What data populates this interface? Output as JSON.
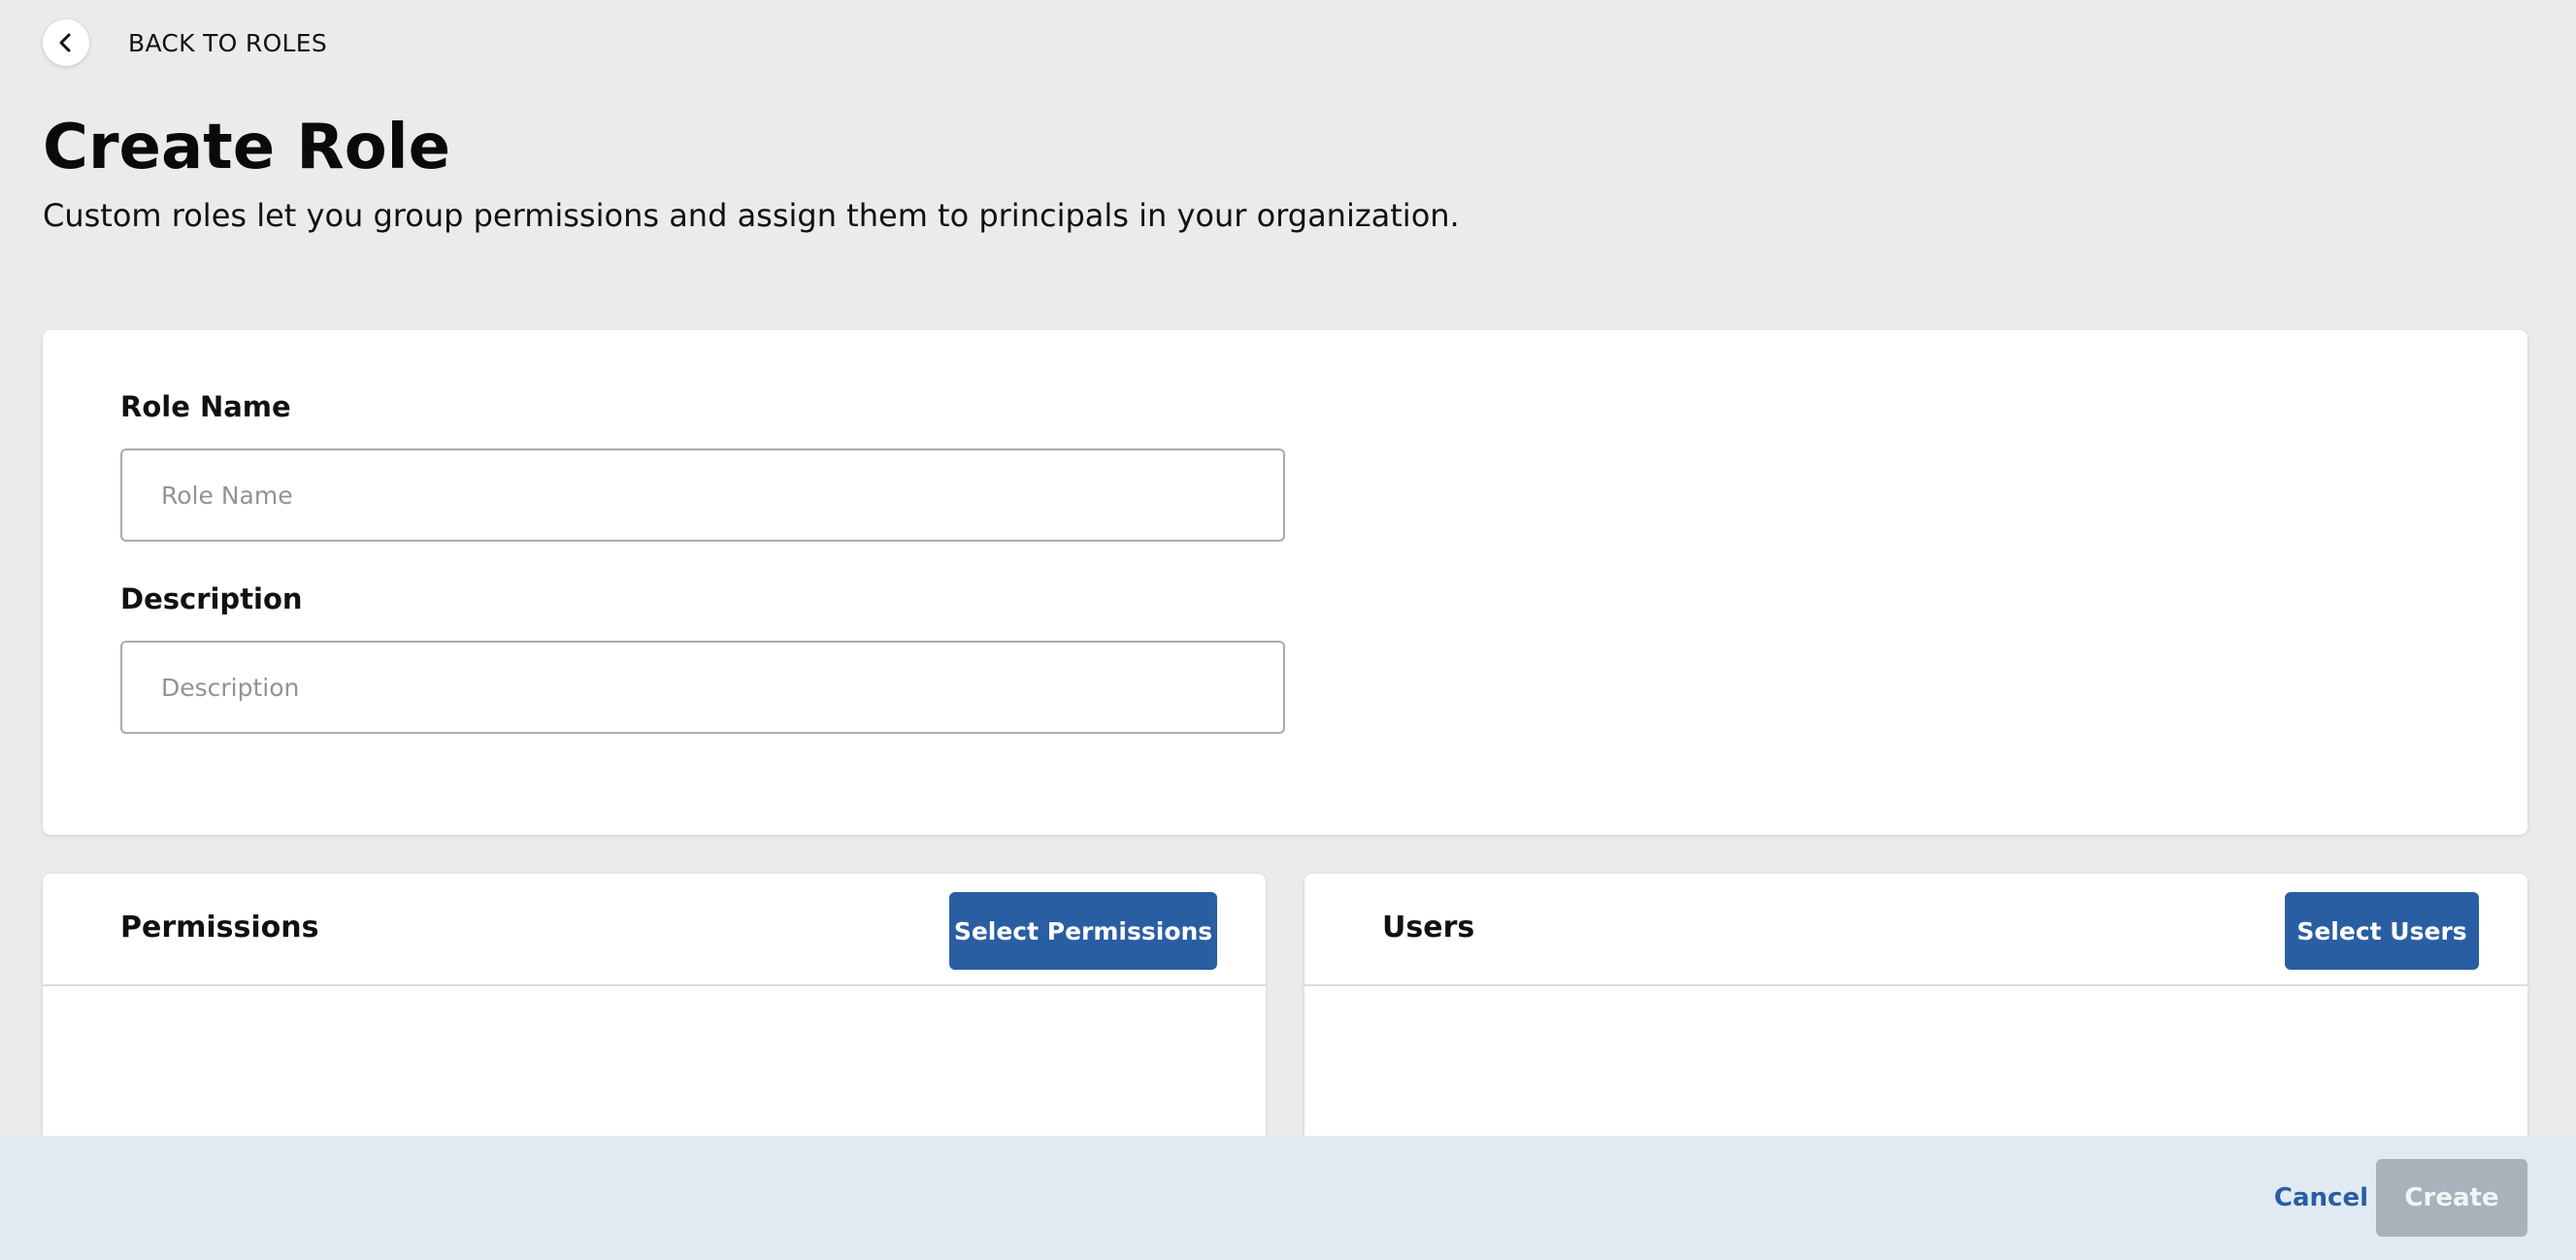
{
  "nav": {
    "back_label": "BACK TO ROLES",
    "back_icon": "chevron-left-icon"
  },
  "header": {
    "title": "Create Role",
    "subtitle": "Custom roles let you group permissions and assign them to principals in your organization."
  },
  "form": {
    "role_name": {
      "label": "Role Name",
      "placeholder": "Role Name",
      "value": ""
    },
    "description": {
      "label": "Description",
      "placeholder": "Description",
      "value": ""
    }
  },
  "permissions_panel": {
    "title": "Permissions",
    "button_label": "Select Permissions"
  },
  "users_panel": {
    "title": "Users",
    "button_label": "Select Users"
  },
  "footer": {
    "cancel_label": "Cancel",
    "create_label": "Create"
  },
  "colors": {
    "page_background": "#ebebeb",
    "primary": "#2a5ea3",
    "disabled_button": "#a9b2bb",
    "footer_background": "#e1eaf3"
  }
}
